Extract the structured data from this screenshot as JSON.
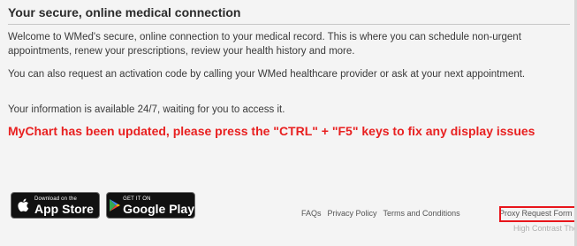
{
  "section": {
    "title": "Your secure, online medical connection",
    "paragraphs": [
      "Welcome to WMed's secure, online connection to your medical record. This is where you can schedule non-urgent appointments, renew your prescriptions, review your health history and more.",
      "You can also request an activation code by calling your WMed healthcare provider or ask at your next appointment.",
      "Your information is available 24/7, waiting for you to access it."
    ],
    "alert": "MyChart has been updated, please press the \"CTRL\" + \"F5\" keys to fix any display issues"
  },
  "stores": {
    "app_store": {
      "small": "Download on the",
      "big": "App Store",
      "icon": "apple-icon"
    },
    "google_play": {
      "small": "GET IT ON",
      "big": "Google Play",
      "icon": "play-icon"
    }
  },
  "footer": {
    "links": [
      "FAQs",
      "Privacy Policy",
      "Terms and Conditions"
    ],
    "proxy": "Proxy Request Form",
    "contrast": "High Contrast Theme"
  },
  "colors": {
    "alert": "#e82020",
    "highlight": "#e8151b",
    "background": "#f4f4f4"
  }
}
